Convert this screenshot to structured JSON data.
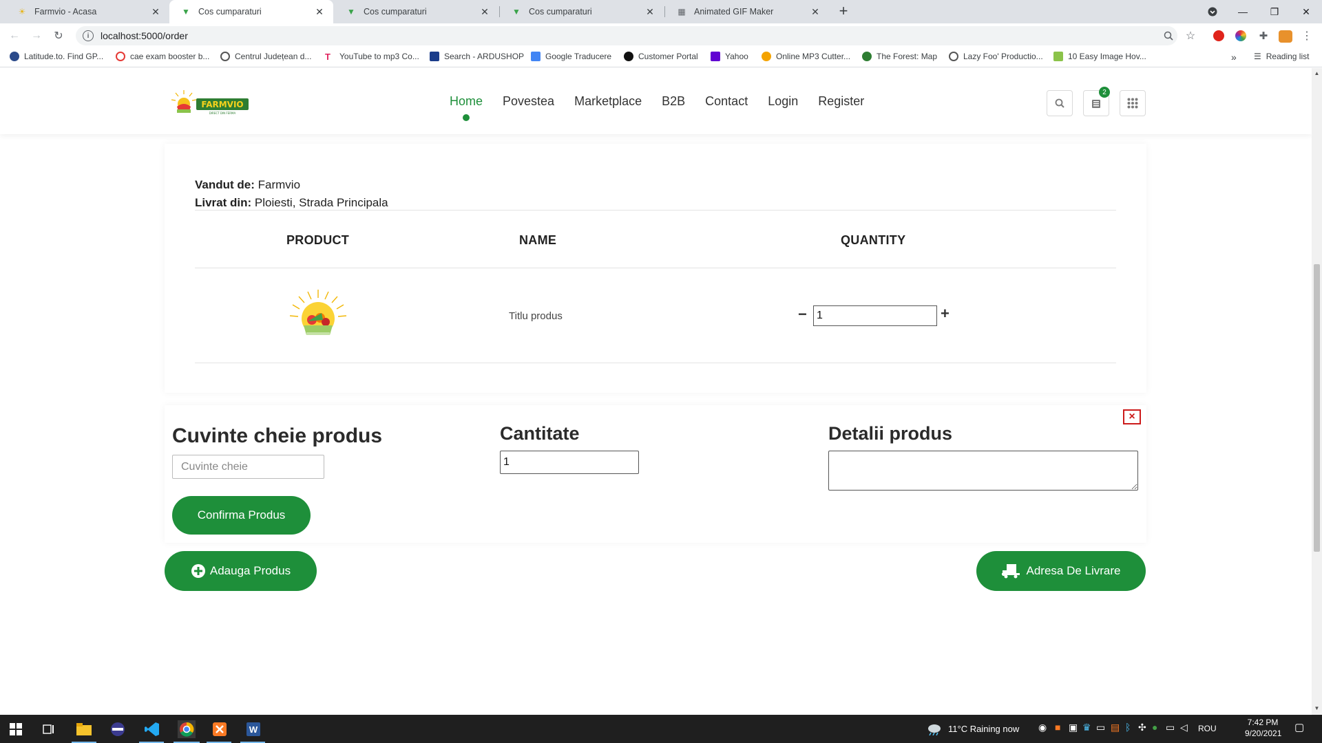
{
  "browser": {
    "tabs": [
      {
        "title": "Farmvio - Acasa",
        "active": false
      },
      {
        "title": "Cos cumparaturi",
        "active": true
      },
      {
        "title": "Cos cumparaturi",
        "active": false
      },
      {
        "title": "Cos cumparaturi",
        "active": false
      },
      {
        "title": "Animated GIF Maker",
        "active": false
      }
    ],
    "url": "localhost:5000/order",
    "bookmarks": [
      "Latitude.to. Find GP...",
      "cae exam booster b...",
      "Centrul Județean d...",
      "YouTube to mp3 Co...",
      "Search - ARDUSHOP",
      "Google Traducere",
      "Customer Portal",
      "Yahoo",
      "Online MP3 Cutter...",
      "The Forest: Map",
      "Lazy Foo' Productio...",
      "10 Easy Image Hov..."
    ],
    "reading_list": "Reading list"
  },
  "site": {
    "logo_text": "FARMVIO",
    "logo_tagline": "DIRECT DIN FERMA",
    "nav": [
      "Home",
      "Povestea",
      "Marketplace",
      "B2B",
      "Contact",
      "Login",
      "Register"
    ],
    "active_nav": "Home",
    "cart_count": "2",
    "accent_color": "#1e8f3a"
  },
  "order": {
    "sold_by_label": "Vandut de:",
    "sold_by_value": "Farmvio",
    "shipped_from_label": "Livrat din:",
    "shipped_from_value": "Ploiesti, Strada Principala",
    "columns": [
      "PRODUCT",
      "NAME",
      "QUANTITY"
    ],
    "item": {
      "name": "Titlu produs",
      "quantity": "1"
    },
    "minus": "−",
    "plus": "+"
  },
  "form": {
    "keywords_title": "Cuvinte cheie produs",
    "keywords_placeholder": "Cuvinte cheie",
    "quantity_title": "Cantitate",
    "quantity_value": "1",
    "details_title": "Detalii produs",
    "close_symbol": "×",
    "confirm_label": "Confirma Produs"
  },
  "actions": {
    "add_product": "Adauga Produs",
    "delivery_address": "Adresa De Livrare"
  },
  "taskbar": {
    "weather": "11°C  Raining now",
    "language": "ROU",
    "time": "7:42 PM",
    "date": "9/20/2021"
  }
}
